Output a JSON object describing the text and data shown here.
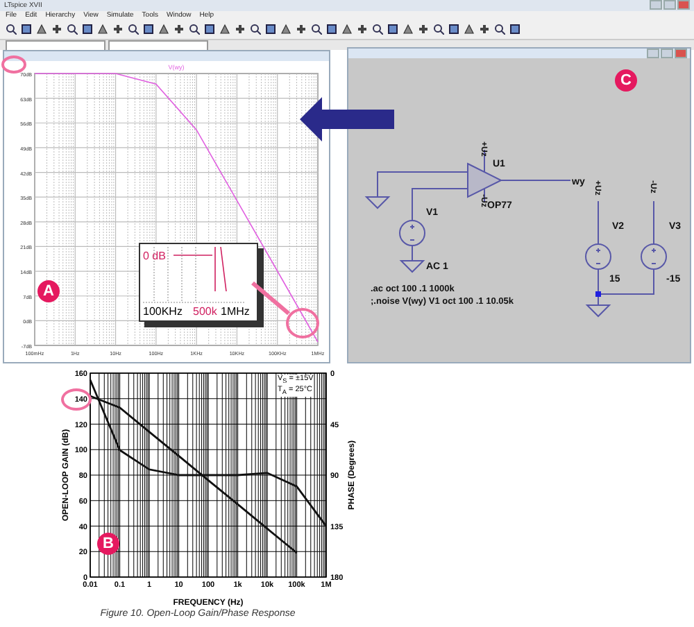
{
  "window": {
    "title": "LTspice XVII"
  },
  "menu": [
    "File",
    "Edit",
    "Hierarchy",
    "View",
    "Simulate",
    "Tools",
    "Window",
    "Help"
  ],
  "plot_window": {
    "chart_data": {
      "type": "line",
      "grid": true,
      "categories": [
        "100mHz",
        "1Hz",
        "10Hz",
        "100Hz",
        "1KHz",
        "10KHz",
        "100KHz",
        "1MHz"
      ],
      "ylim": [
        -7,
        70
      ],
      "yticks": [
        {
          "value": 70,
          "label": "70dB"
        },
        {
          "value": 63,
          "label": "63dB"
        },
        {
          "value": 56,
          "label": "56dB"
        },
        {
          "value": 49,
          "label": "49dB"
        },
        {
          "value": 42,
          "label": "42dB"
        },
        {
          "value": 35,
          "label": "35dB"
        },
        {
          "value": 28,
          "label": "28dB"
        },
        {
          "value": 21,
          "label": "21dB"
        },
        {
          "value": 14,
          "label": "14dB"
        },
        {
          "value": 7,
          "label": "7dB"
        },
        {
          "value": 0,
          "label": "0dB"
        },
        {
          "value": -7,
          "label": "-7dB"
        }
      ],
      "series": [
        {
          "name": "V(wy)",
          "color": "#e060e0",
          "values": [
            70,
            70,
            70,
            67,
            54,
            34,
            14,
            -6
          ]
        }
      ]
    },
    "inset": {
      "level_label": "0 dB",
      "start_label": "100KHz",
      "marker_label": "500k",
      "end_label": "1MHz"
    }
  },
  "schematic_window": {
    "labels": {
      "u1": "U1",
      "model": "OP77",
      "net": "wy",
      "v1": "V1",
      "v1_value": "AC 1",
      "v2": "V2",
      "v2_value": "15",
      "v3": "V3",
      "v3_value": "-15",
      "pin_pos": "+Uz",
      "pin_neg": "-Uz",
      "v2_net": "+Uz",
      "v3_net": "-Uz"
    },
    "directives": [
      ".ac oct 100 .1 1000k",
      ";.noise V(wy) V1 oct 100 .1 10.05k"
    ]
  },
  "badges": [
    "A",
    "B",
    "C"
  ],
  "datasheet_figure": {
    "chart_data": {
      "type": "line",
      "grid": true,
      "xlabel": "FREQUENCY (Hz)",
      "ylabel": "OPEN-LOOP GAIN (dB)",
      "y2label": "PHASE (Degrees)",
      "ylim": [
        0,
        160
      ],
      "y2lim": [
        180,
        0
      ],
      "categories": [
        "0.01",
        "0.1",
        "1",
        "10",
        "100",
        "1k",
        "10k",
        "100k",
        "1M"
      ],
      "yticks": [
        0,
        20,
        40,
        60,
        80,
        100,
        120,
        140,
        160
      ],
      "y2ticks": [
        0,
        45,
        90,
        135,
        180
      ],
      "series": [
        {
          "color": "#111111",
          "values": [
            142,
            133,
            114,
            95,
            76,
            57,
            38,
            19,
            null
          ]
        },
        {
          "axis": "y2",
          "color": "#111111",
          "values": [
            6,
            68,
            85,
            90,
            90,
            90,
            88,
            100,
            135
          ]
        }
      ]
    },
    "conditions": [
      "V$_{S}$ = ±15V",
      "T$_{A}$ = 25°C"
    ],
    "caption": "Figure 10. Open-Loop Gain/Phase Response"
  }
}
